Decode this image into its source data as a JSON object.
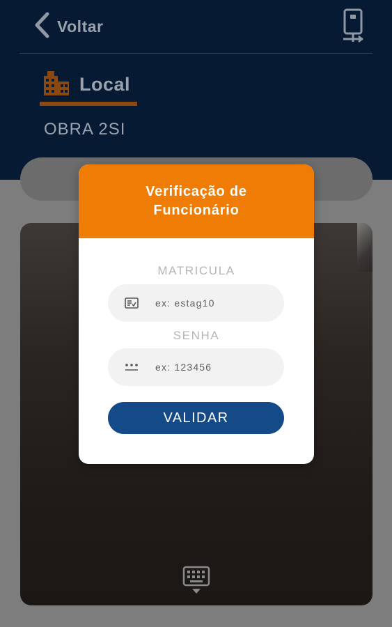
{
  "header": {
    "back_label": "Voltar",
    "local_label": "Local",
    "site_name": "OBRA 2SI"
  },
  "modal": {
    "title": "Verificação de Funcionário",
    "matricula": {
      "label": "MATRICULA",
      "placeholder": "ex: estag10",
      "value": ""
    },
    "senha": {
      "label": "SENHA",
      "placeholder": "ex: 123456",
      "value": ""
    },
    "validate_label": "VALIDAR"
  },
  "icons": {
    "back": "chevron-left-icon",
    "device": "device-checkin-icon",
    "local": "buildings-icon",
    "matricula": "id-card-icon",
    "senha": "password-dots-icon",
    "keyboard": "keyboard-icon"
  },
  "colors": {
    "header_bg": "#061a33",
    "accent_orange": "#ef7d05",
    "button_blue": "#144a87",
    "local_underline": "#8a4a0f"
  }
}
